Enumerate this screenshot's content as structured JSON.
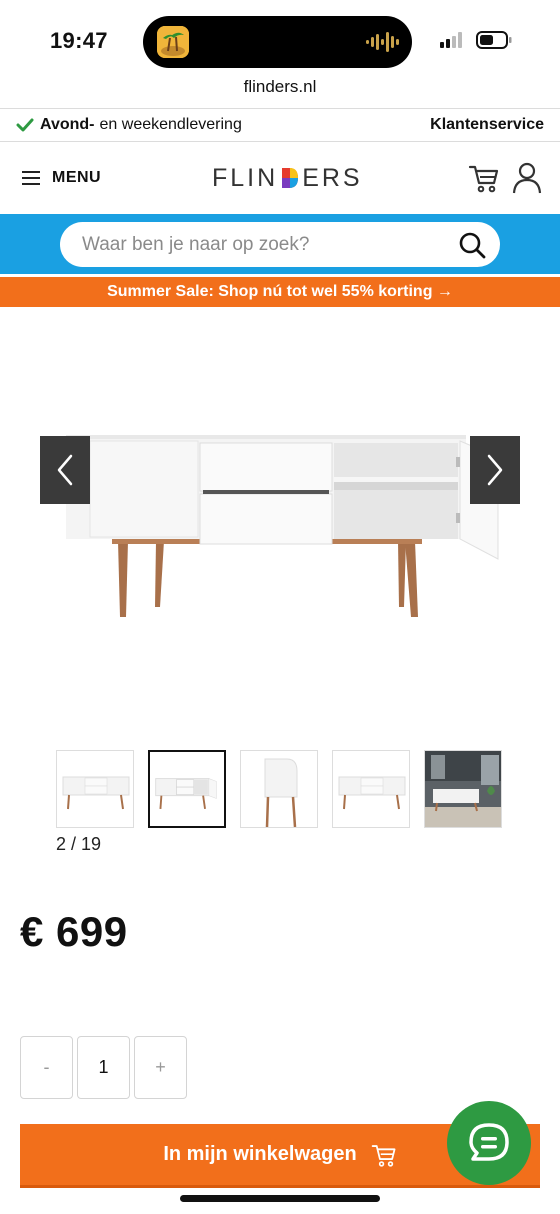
{
  "status_bar": {
    "time": "19:47"
  },
  "browser": {
    "url": "flinders.nl"
  },
  "top_strip": {
    "delivery_bold": "Avond-",
    "delivery_rest": "en weekendlevering",
    "service_link": "Klantenservice"
  },
  "header": {
    "menu_label": "MENU",
    "logo_text_left": "FLIN",
    "logo_text_right": "ERS"
  },
  "search": {
    "placeholder": "Waar ben je naar op zoek?"
  },
  "promo": {
    "sale_text": "Summer Sale: Shop nú tot wel 55% korting →"
  },
  "gallery": {
    "current": 2,
    "total": 19,
    "counter_text": "2 / 19",
    "thumbnail_count": 5,
    "active_index": 1
  },
  "product": {
    "price": "€ 699"
  },
  "quantity": {
    "minus": "-",
    "value": "1",
    "plus": "+"
  },
  "cart_button": {
    "label": "In mijn winkelwagen"
  },
  "colors": {
    "accent_orange": "#f26f1b",
    "search_blue": "#1aa0e2",
    "chat_green": "#2e9a42",
    "check_green": "#2e9a42"
  },
  "icons": [
    "check-icon",
    "hamburger-icon",
    "cart-icon",
    "account-icon",
    "search-icon",
    "chevron-left-icon",
    "chevron-right-icon",
    "chat-icon"
  ]
}
